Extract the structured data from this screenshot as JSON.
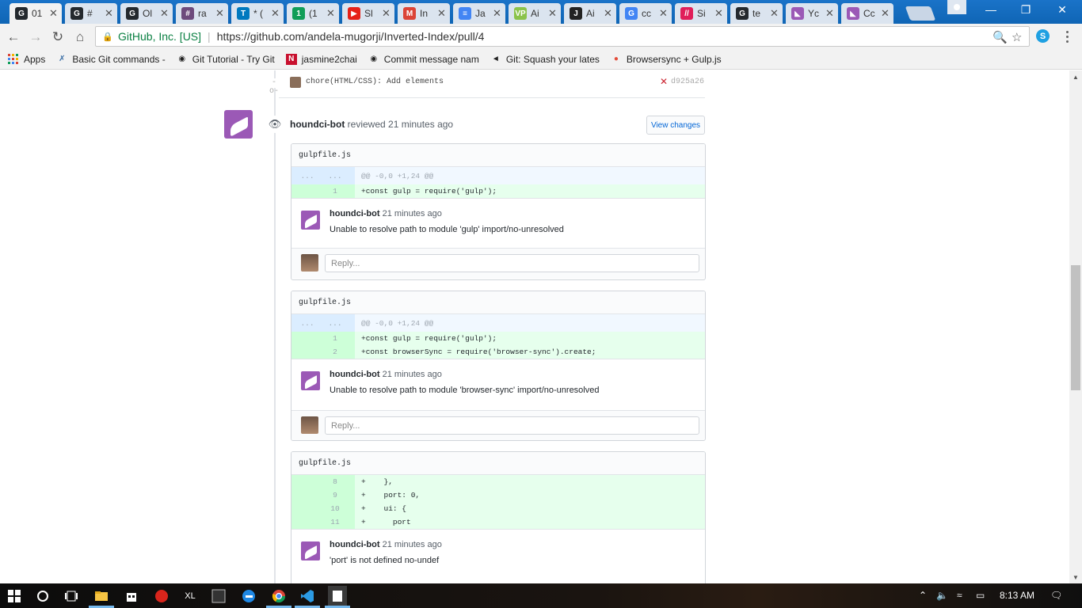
{
  "browser": {
    "tabs": [
      {
        "title": "01",
        "icon": "github-icon",
        "color": "#24292e",
        "active": true
      },
      {
        "title": "#",
        "icon": "github-icon",
        "color": "#24292e"
      },
      {
        "title": "Ol",
        "icon": "github-icon",
        "color": "#24292e"
      },
      {
        "title": "ra",
        "icon": "hashtag-icon",
        "color": "#6d4a7c"
      },
      {
        "title": "* (",
        "icon": "trello-icon",
        "color": "#0079bf"
      },
      {
        "title": "(1",
        "icon": "hangouts-icon",
        "color": "#0f9d58"
      },
      {
        "title": "Sl",
        "icon": "youtube-icon",
        "color": "#e62117"
      },
      {
        "title": "In",
        "icon": "gmail-icon",
        "color": "#db4437"
      },
      {
        "title": "Ja",
        "icon": "docs-icon",
        "color": "#4285f4"
      },
      {
        "title": "Ai",
        "icon": "vp-icon",
        "color": "#8bc34a"
      },
      {
        "title": "Ai",
        "icon": "j-icon",
        "color": "#222222"
      },
      {
        "title": "cc",
        "icon": "google-icon",
        "color": "#4285f4"
      },
      {
        "title": "Si",
        "icon": "slack-like-icon",
        "color": "#e01e5a"
      },
      {
        "title": "te",
        "icon": "github-icon",
        "color": "#24292e"
      },
      {
        "title": "Yc",
        "icon": "houndci-icon",
        "color": "#9b59b6"
      },
      {
        "title": "Cc",
        "icon": "houndci-icon",
        "color": "#9b59b6"
      }
    ],
    "window_controls": {
      "minimize": "—",
      "restore": "❐",
      "close": "✕"
    },
    "nav": {
      "back": "←",
      "forward": "→",
      "reload": "↻",
      "home": "⌂"
    },
    "ev_label": "GitHub, Inc. [US]",
    "url": "https://github.com/andela-mugorji/Inverted-Index/pull/4",
    "bookmarks": [
      {
        "label": "Apps",
        "icon": "apps-grid-icon"
      },
      {
        "label": "Basic Git commands -",
        "icon": "git-commands-icon"
      },
      {
        "label": "Git Tutorial - Try Git",
        "icon": "octocat-icon"
      },
      {
        "label": "jasmine2chai",
        "icon": "n-icon"
      },
      {
        "label": "Commit message nam",
        "icon": "github-icon"
      },
      {
        "label": "Git: Squash your lates",
        "icon": "megaphone-icon"
      },
      {
        "label": "Browsersync + Gulp.js",
        "icon": "browsersync-icon"
      }
    ]
  },
  "commit": {
    "message": "chore(HTML/CSS): Add elements",
    "sha": "d925a26",
    "status": "✕"
  },
  "review": {
    "author": "houndci-bot",
    "action": "reviewed",
    "time": "21 minutes ago",
    "view_changes_label": "View changes"
  },
  "files": [
    {
      "name": "gulpfile.js",
      "hunk_left": "...",
      "hunk_right": "...",
      "hunk": "@@ -0,0 +1,24 @@",
      "lines": [
        {
          "num": "1",
          "code": "+const gulp = require('gulp');"
        }
      ],
      "comment": {
        "author": "houndci-bot",
        "time": "21 minutes ago",
        "body": "Unable to resolve path to module 'gulp' import/no-unresolved"
      },
      "reply_placeholder": "Reply..."
    },
    {
      "name": "gulpfile.js",
      "hunk_left": "...",
      "hunk_right": "...",
      "hunk": "@@ -0,0 +1,24 @@",
      "lines": [
        {
          "num": "1",
          "code": "+const gulp = require('gulp');"
        },
        {
          "num": "2",
          "code": "+const browserSync = require('browser-sync').create;"
        }
      ],
      "comment": {
        "author": "houndci-bot",
        "time": "21 minutes ago",
        "body": "Unable to resolve path to module 'browser-sync' import/no-unresolved"
      },
      "reply_placeholder": "Reply..."
    },
    {
      "name": "gulpfile.js",
      "lines": [
        {
          "num": "8",
          "code": "+    },"
        },
        {
          "num": "9",
          "code": "+    port: 0,"
        },
        {
          "num": "10",
          "code": "+    ui: {"
        },
        {
          "num": "11",
          "code": "+      port"
        }
      ],
      "comment": {
        "author": "houndci-bot",
        "time": "21 minutes ago",
        "body": "'port' is not defined no-undef"
      }
    }
  ],
  "taskbar": {
    "clock": "8:13 AM",
    "apps": [
      "start-icon",
      "cortana-icon",
      "task-view-icon",
      "file-explorer-icon",
      "store-icon",
      "gom-player-icon",
      "xl-app-icon",
      "kmplayer-icon",
      "edge-icon",
      "chrome-icon",
      "vscode-icon",
      "notepad-icon"
    ]
  }
}
